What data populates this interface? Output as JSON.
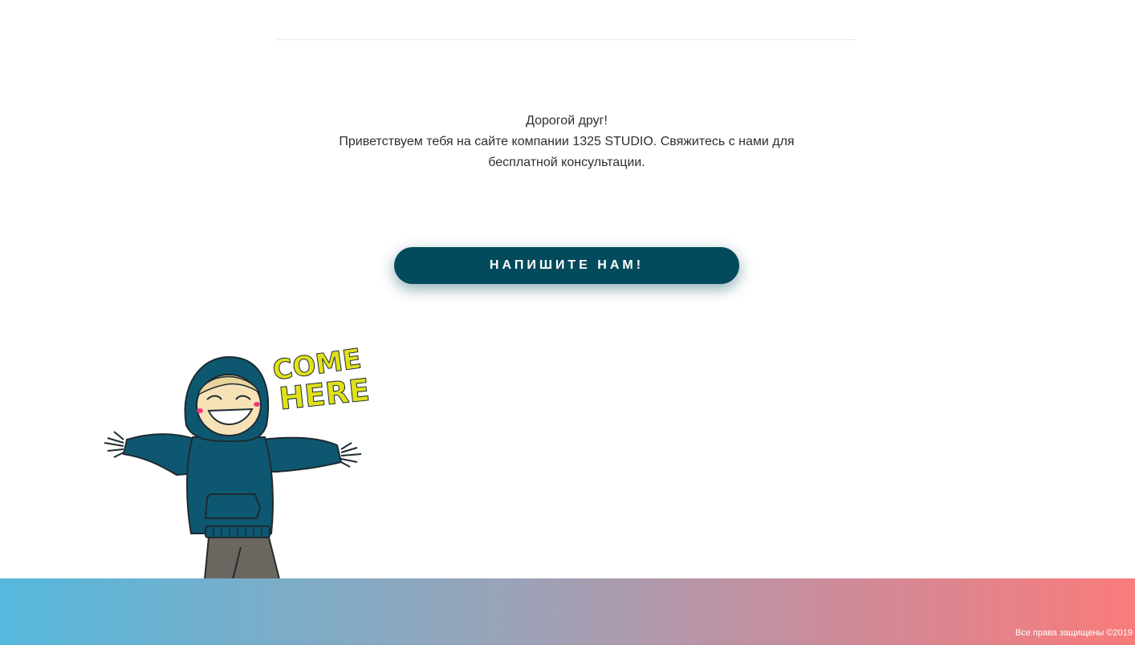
{
  "intro": {
    "line1": "Дорогой друг!",
    "line2": "Приветствуем тебя на сайте компании 1325 STUDIO. Свяжитесь с нами для",
    "line3": "бесплатной консультации."
  },
  "cta": {
    "label": "НАПИШИТЕ НАМ!"
  },
  "mascot": {
    "text_line1": "COME",
    "text_line2": "HERE",
    "icon": "waving-hoodie-character"
  },
  "footer": {
    "copyright": "Все права защищены ©2019"
  },
  "colors": {
    "button": "#034b5c",
    "hoodie": "#0d5870",
    "sticker_text": "#e1e11a",
    "footer_start": "#55b8dc",
    "footer_end": "#f97b7b"
  }
}
